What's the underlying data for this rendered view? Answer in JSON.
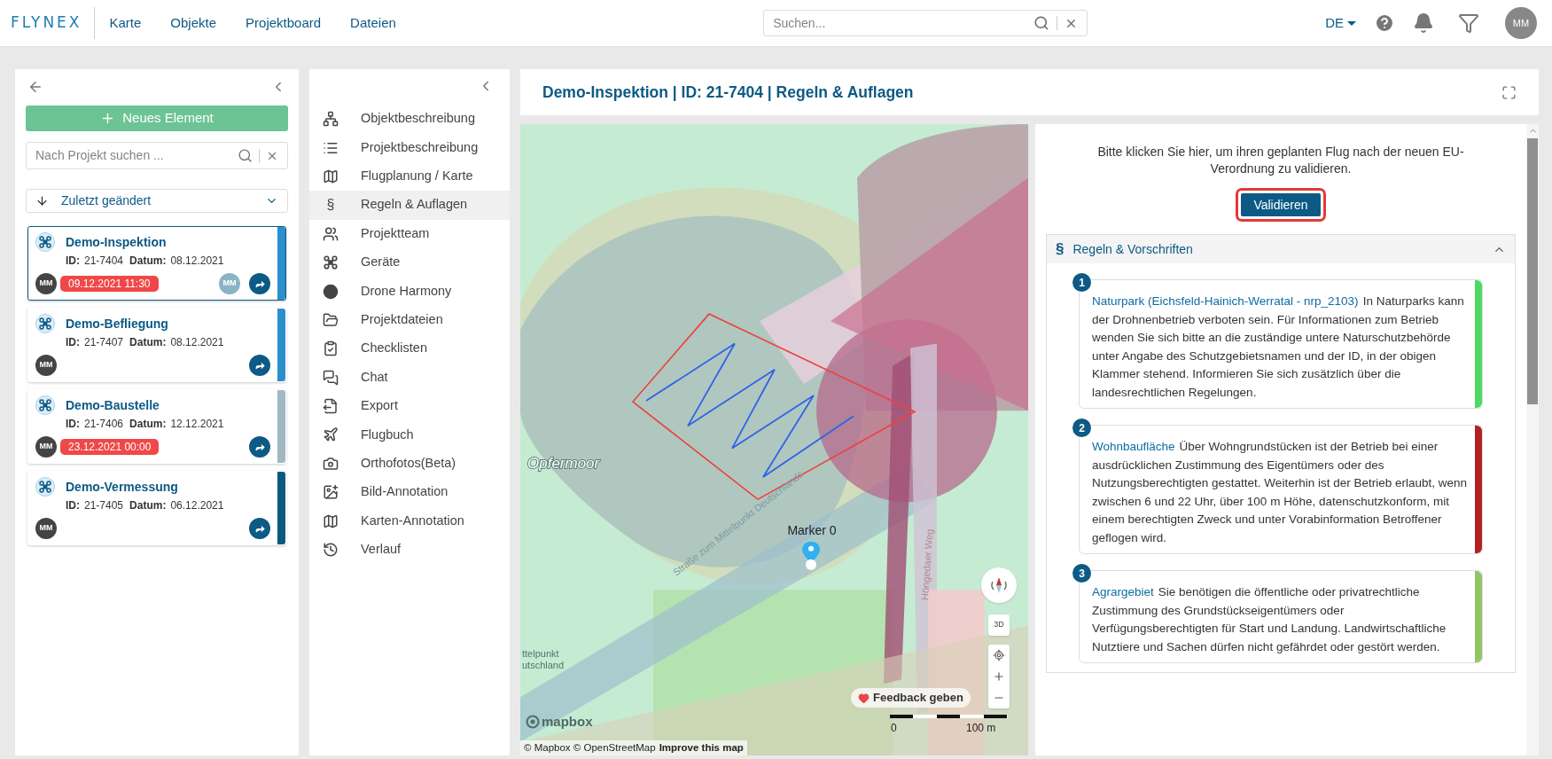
{
  "topbar": {
    "brand": "FLYNEX",
    "nav": [
      {
        "label": "Karte"
      },
      {
        "label": "Objekte"
      },
      {
        "label": "Projektboard"
      },
      {
        "label": "Dateien"
      }
    ],
    "search": {
      "placeholder": "Suchen..."
    },
    "language": "DE",
    "user_initials": "MM"
  },
  "project_list": {
    "new_button": "Neues Element",
    "search": {
      "placeholder": "Nach Projekt suchen ..."
    },
    "sort": "Zuletzt geändert",
    "cards": [
      {
        "title": "Demo-Inspektion",
        "id_label": "ID:",
        "id": "21-7404",
        "date_label": "Datum:",
        "date": "08.12.2021",
        "owner": "MM",
        "deadline": "09.12.2021 11:30",
        "assignee": "MM",
        "color": "#2a8fcb",
        "selected": true
      },
      {
        "title": "Demo-Befliegung",
        "id_label": "ID:",
        "id": "21-7407",
        "date_label": "Datum:",
        "date": "08.12.2021",
        "owner": "MM",
        "color": "#2a8fcb",
        "selected": false
      },
      {
        "title": "Demo-Baustelle",
        "id_label": "ID:",
        "id": "21-7406",
        "date_label": "Datum:",
        "date": "12.12.2021",
        "owner": "MM",
        "deadline": "23.12.2021 00:00",
        "color": "#a0b8c2",
        "selected": false
      },
      {
        "title": "Demo-Vermessung",
        "id_label": "ID:",
        "id": "21-7405",
        "date_label": "Datum:",
        "date": "06.12.2021",
        "owner": "MM",
        "color": "#0a5a80",
        "selected": false
      }
    ]
  },
  "menu": {
    "items": [
      {
        "label": "Objektbeschreibung",
        "selected": false
      },
      {
        "label": "Projektbeschreibung",
        "selected": false
      },
      {
        "label": "Flugplanung / Karte",
        "selected": false
      },
      {
        "label": "Regeln & Auflagen",
        "symbol": "§",
        "selected": true
      },
      {
        "label": "Projektteam",
        "selected": false
      },
      {
        "label": "Geräte",
        "selected": false
      },
      {
        "label": "Drone Harmony",
        "selected": false
      },
      {
        "label": "Projektdateien",
        "selected": false
      },
      {
        "label": "Checklisten",
        "selected": false
      },
      {
        "label": "Chat",
        "selected": false
      },
      {
        "label": "Export",
        "selected": false
      },
      {
        "label": "Flugbuch",
        "selected": false
      },
      {
        "label": "Orthofotos(Beta)",
        "selected": false
      },
      {
        "label": "Bild-Annotation",
        "selected": false
      },
      {
        "label": "Karten-Annotation",
        "selected": false
      },
      {
        "label": "Verlauf",
        "selected": false
      }
    ]
  },
  "page": {
    "title": "Demo-Inspektion | ID: 21-7404 | Regeln & Auflagen"
  },
  "map": {
    "labels": [
      {
        "text": "Opfermoor"
      },
      {
        "text": "Straße zum Mittelpunkt Deutschlands"
      },
      {
        "text": "Höngedaer Weg"
      },
      {
        "text": "ttelpunkt"
      },
      {
        "text": "utschland"
      }
    ],
    "marker": "Marker 0",
    "three_d": "3D",
    "feedback": "Feedback geben",
    "scale_start": "0",
    "scale_end": "100 m",
    "logo": "mapbox",
    "attribution": "© Mapbox © OpenStreetMap",
    "improve_link": "Improve this map"
  },
  "rules_panel": {
    "intro": "Bitte klicken Sie hier, um ihren geplanten Flug nach der neuen EU-Verordnung zu validieren.",
    "validate_button": {
      "label": "Validieren",
      "highlighted": true
    },
    "section": {
      "symbol": "§",
      "title": "Regeln & Vorschriften",
      "expanded": true
    },
    "rules": [
      {
        "number": "1",
        "title": "Naturpark (Eichsfeld-Hainich-Werratal - nrp_2103)",
        "text": "In Naturparks kann der Drohnenbetrieb verboten sein. Für Informationen zum Betrieb wenden Sie sich bitte an die zuständige untere Naturschutzbehörde unter Angabe des Schutzgebietsnamen und der ID, in der obigen Klammer stehend. Informieren Sie sich zusätzlich über die landesrechtlichen Regelungen.",
        "color": "#4cd964"
      },
      {
        "number": "2",
        "title": "Wohnbaufläche",
        "text": "Über Wohngrundstücken ist der Betrieb bei einer ausdrücklichen Zustimmung des Eigentümers oder des Nutzungsberechtigten gestattet. Weiterhin ist der Betrieb erlaubt, wenn zwischen 6 und 22 Uhr, über 100 m Höhe, datenschutzkonform, mit einem berechtigten Zweck und unter Vorabinformation Betroffener geflogen wird.",
        "color": "#b22222"
      },
      {
        "number": "3",
        "title": "Agrargebiet",
        "text": "Sie benötigen die öffentliche oder privatrechtliche Zustimmung des Grundstückseigentümers oder Verfügungsberechtigten für Start und Landung. Landwirtschaftliche Nutztiere und Sachen dürfen nicht gefährdet oder gestört werden.",
        "color": "#93c468"
      }
    ]
  }
}
